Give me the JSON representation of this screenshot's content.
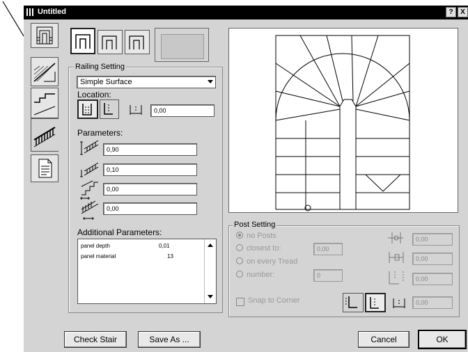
{
  "window": {
    "title": "Untitled",
    "help_button": "?",
    "close_button": "X"
  },
  "railing_setting": {
    "group_label": "Railing Setting",
    "type_dropdown": "Simple Surface",
    "location_label": "Location:",
    "location_offset": "0,00",
    "parameters_label": "Parameters:",
    "param_values": [
      "0,90",
      "0,10",
      "0,00",
      "0,00"
    ],
    "additional_label": "Additional Parameters:",
    "additional": [
      {
        "name": "panel depth",
        "value": "0,01"
      },
      {
        "name": "panel material",
        "value": "13"
      }
    ]
  },
  "post_setting": {
    "group_label": "Post Setting",
    "options": [
      "no Posts",
      "closest to:",
      "on every Tread",
      "number:"
    ],
    "selected": "no Posts",
    "closest_value": "0,00",
    "number_value": "0",
    "snap_label": "Snap to Corner",
    "right_values": [
      "0,00",
      "0,00",
      "0,00",
      "0,00"
    ]
  },
  "buttons": {
    "check_stair": "Check Stair",
    "save_as": "Save As ...",
    "cancel": "Cancel",
    "ok": "OK"
  },
  "colors": {
    "dialog_bg": "#d4d4d4",
    "titlebar": "#000000",
    "swatch": "#c8c8c8"
  },
  "icons": [
    "plan-view-icon",
    "stair-section-icon",
    "stair-elevation-icon",
    "railing-icon",
    "document-icon"
  ]
}
